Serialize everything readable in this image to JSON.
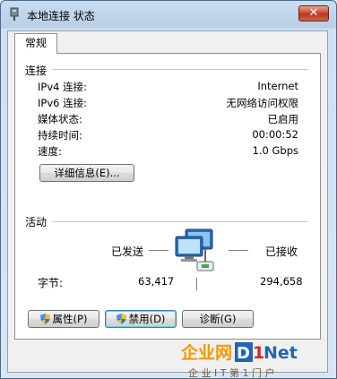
{
  "window": {
    "title": "本地连接 状态",
    "close_label": "✕"
  },
  "tabs": [
    {
      "label": "常规"
    }
  ],
  "connection": {
    "group_label": "连接",
    "rows": [
      {
        "label": "IPv4 连接:",
        "value": "Internet"
      },
      {
        "label": "IPv6 连接:",
        "value": "无网络访问权限"
      },
      {
        "label": "媒体状态:",
        "value": "已启用"
      },
      {
        "label": "持续时间:",
        "value": "00:00:52"
      },
      {
        "label": "速度:",
        "value": "1.0 Gbps"
      }
    ],
    "details_button": "详细信息(E)..."
  },
  "activity": {
    "group_label": "活动",
    "sent_label": "已发送",
    "received_label": "已接收",
    "bytes_label": "字节:",
    "bytes_sent": "63,417",
    "bytes_received": "294,658"
  },
  "buttons": {
    "properties": "属性(P)",
    "disable": "禁用(D)",
    "diagnose": "诊断(G)"
  },
  "watermark": {
    "brand": "企业网D1Net",
    "tagline": "企 业 I T 第 1 门 户"
  },
  "colors": {
    "accent": "#1f65b7",
    "watermark_orange": "#f39800",
    "watermark_red": "#d7261e"
  }
}
